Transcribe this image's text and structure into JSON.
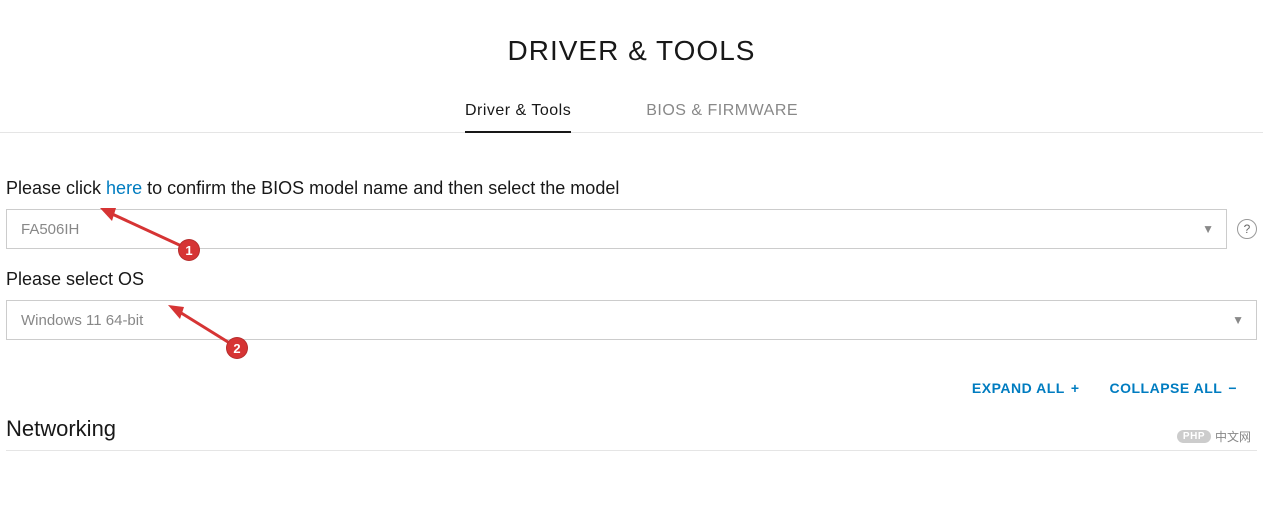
{
  "header": {
    "title": "DRIVER & TOOLS"
  },
  "tabs": {
    "driver_tools": "Driver & Tools",
    "bios_firmware": "BIOS & FIRMWARE"
  },
  "bios_label": {
    "prefix": "Please click ",
    "link": "here",
    "suffix": " to confirm the BIOS model name and then select the model"
  },
  "model_select": {
    "value": "FA506IH"
  },
  "os_label": "Please select OS",
  "os_select": {
    "value": "Windows 11 64-bit"
  },
  "actions": {
    "expand": "EXPAND ALL",
    "expand_sign": "+",
    "collapse": "COLLAPSE ALL",
    "collapse_sign": "−"
  },
  "section": {
    "networking": "Networking"
  },
  "annotations": {
    "badge1": "1",
    "badge2": "2"
  },
  "watermark": {
    "pill": "PHP",
    "text": "中文网"
  },
  "help": {
    "symbol": "?"
  }
}
